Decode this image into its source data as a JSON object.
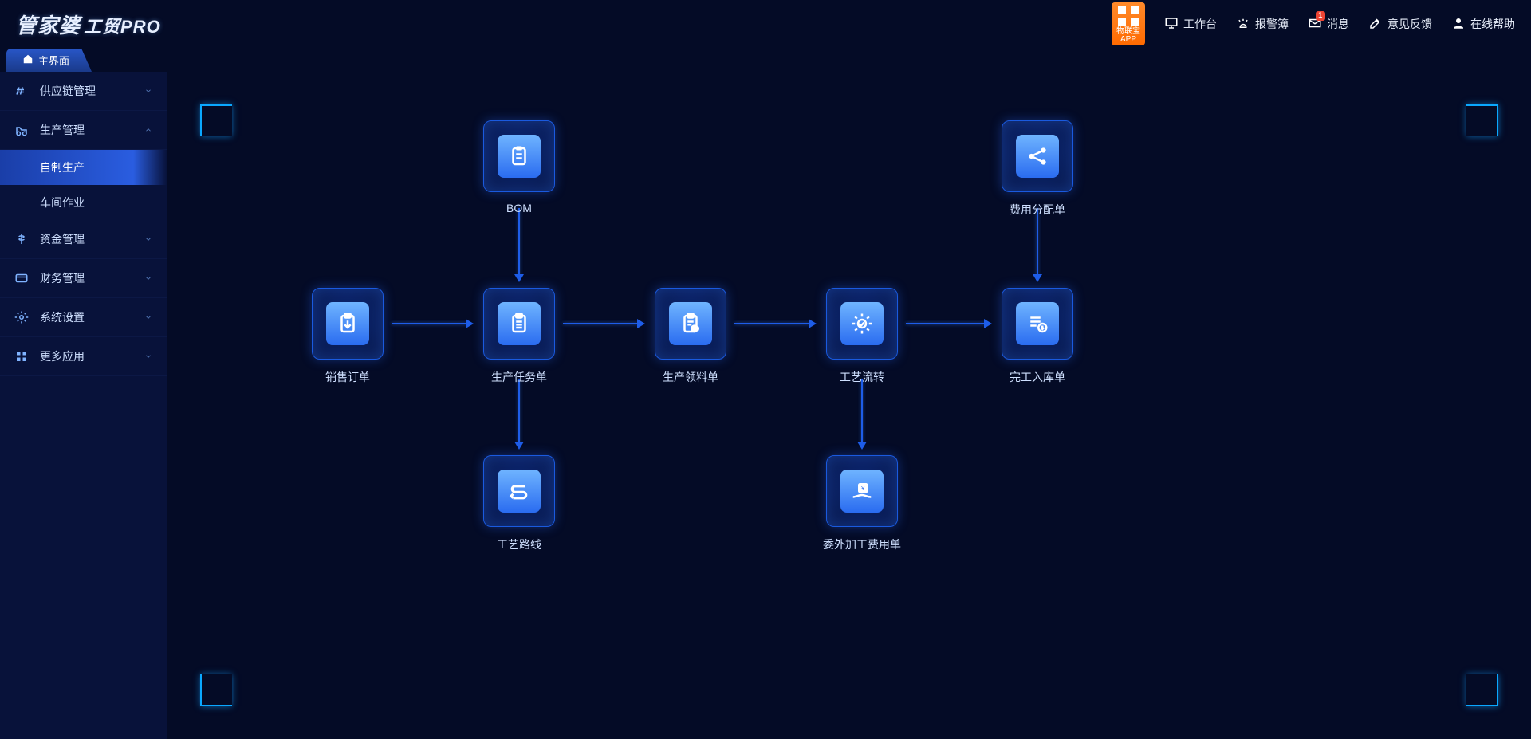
{
  "header": {
    "logo_main": "管家婆",
    "logo_sub": "工贸PRO",
    "app_badge": "物联宝\nAPP",
    "nav": [
      {
        "label": "工作台",
        "icon": "monitor-icon"
      },
      {
        "label": "报警簿",
        "icon": "alarm-icon"
      },
      {
        "label": "消息",
        "icon": "mail-icon",
        "badge": "1"
      },
      {
        "label": "意见反馈",
        "icon": "edit-icon"
      },
      {
        "label": "在线帮助",
        "icon": "user-icon"
      }
    ]
  },
  "tab": {
    "label": "主界面"
  },
  "sidebar": {
    "items": [
      {
        "label": "供应链管理",
        "icon": "chain-icon",
        "expanded": false
      },
      {
        "label": "生产管理",
        "icon": "factory-icon",
        "expanded": true,
        "children": [
          {
            "label": "自制生产",
            "active": true
          },
          {
            "label": "车间作业",
            "active": false
          }
        ]
      },
      {
        "label": "资金管理",
        "icon": "money-icon",
        "expanded": false
      },
      {
        "label": "财务管理",
        "icon": "finance-icon",
        "expanded": false
      },
      {
        "label": "系统设置",
        "icon": "gear-icon",
        "expanded": false
      },
      {
        "label": "更多应用",
        "icon": "grid-icon",
        "expanded": false
      }
    ]
  },
  "diagram": {
    "nodes": {
      "bom": {
        "label": "BOM",
        "icon": "clipboard-list-icon"
      },
      "fee": {
        "label": "费用分配单",
        "icon": "share-icon"
      },
      "so": {
        "label": "销售订单",
        "icon": "clipboard-down-icon"
      },
      "task": {
        "label": "生产任务单",
        "icon": "clipboard-lines-icon"
      },
      "pick": {
        "label": "生产领料单",
        "icon": "clipboard-badge-icon"
      },
      "proc": {
        "label": "工艺流转",
        "icon": "gear-cycle-icon"
      },
      "fin": {
        "label": "完工入库单",
        "icon": "list-down-icon"
      },
      "route": {
        "label": "工艺路线",
        "icon": "route-icon"
      },
      "out": {
        "label": "委外加工费用单",
        "icon": "hand-money-icon"
      }
    },
    "edges": [
      [
        "bom",
        "task"
      ],
      [
        "fee",
        "fin"
      ],
      [
        "so",
        "task"
      ],
      [
        "task",
        "pick"
      ],
      [
        "pick",
        "proc"
      ],
      [
        "proc",
        "fin"
      ],
      [
        "task",
        "route"
      ],
      [
        "proc",
        "out"
      ]
    ]
  }
}
